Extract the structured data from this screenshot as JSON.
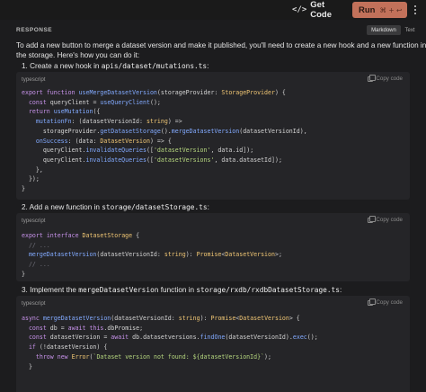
{
  "toolbar": {
    "get_code_label": "Get Code",
    "get_code_icon": "</>",
    "run_label": "Run",
    "run_shortcut": "⌘ + ↩",
    "run_color": "#c2715a"
  },
  "panel": {
    "header": "RESPONSE",
    "tabs": {
      "markdown": "Markdown",
      "text": "Text"
    }
  },
  "intro": {
    "line1": "To add a new button to merge a dataset version and make it published, you'll need to create a new hook and a new function in",
    "line2": "the storage. Here's how you can do it:"
  },
  "steps": [
    {
      "prefix": "1. Create a new hook in ",
      "path": "apis/dataset/mutations.ts",
      "suffix": ":"
    },
    {
      "prefix": "2. Add a new function in ",
      "path": "storage/datasetStorage.ts",
      "suffix": ":"
    },
    {
      "prefix": "3. Implement the ",
      "path": "mergeDatasetVersion",
      "middle": " function in ",
      "path2": "storage/rxdb/rxdbDatasetStorage.ts",
      "suffix": ":"
    }
  ],
  "code_blocks": [
    {
      "lang": "typescript",
      "copy_label": "Copy code",
      "lines": [
        "export function useMergeDatasetVersion(storageProvider: StorageProvider) {",
        "  const queryClient = useQueryClient();",
        "  return useMutation({",
        "    mutationFn: (datasetVersionId: string) =>",
        "      storageProvider.getDatasetStorage().mergeDatasetVersion(datasetVersionId),",
        "    onSuccess: (data: DatasetVersion) => {",
        "      queryClient.invalidateQueries(['datasetVersion', data.id]);",
        "      queryClient.invalidateQueries(['datasetVersions', data.datasetId]);",
        "    },",
        "  });",
        "}"
      ]
    },
    {
      "lang": "typescript",
      "copy_label": "Copy code",
      "lines": [
        "export interface DatasetStorage {",
        "  // ...",
        "  mergeDatasetVersion(datasetVersionId: string): Promise<DatasetVersion>;",
        "  // ...",
        "}"
      ]
    },
    {
      "lang": "typescript",
      "copy_label": "Copy code",
      "lines": [
        "async mergeDatasetVersion(datasetVersionId: string): Promise<DatasetVersion> {",
        "  const db = await this.dbPromise;",
        "  const datasetVersion = await db.datasetversions.findOne(datasetVersionId).exec();",
        "  if (!datasetVersion) {",
        "    throw new Error(`Dataset version not found: ${datasetVersionId}`);",
        "  }"
      ]
    }
  ]
}
